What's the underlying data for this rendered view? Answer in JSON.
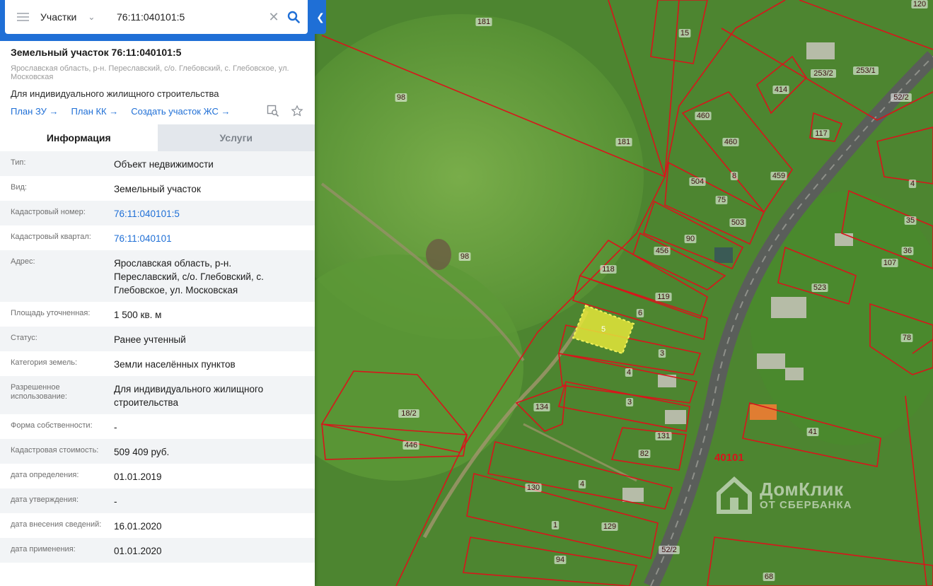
{
  "search": {
    "type_label": "Участки",
    "query": "76:11:040101:5"
  },
  "object": {
    "title": "Земельный участок 76:11:040101:5",
    "address": "Ярославская область, р-н. Переславский, с/о. Глебовский, с. Глебовское, ул. Московская",
    "use": "Для индивидуального жилищного строительства",
    "links": [
      "План ЗУ →",
      "План КК →",
      "Создать участок ЖС →"
    ]
  },
  "tabs": {
    "info": "Информация",
    "services": "Услуги"
  },
  "info_rows": [
    {
      "label": "Тип:",
      "value": "Объект недвижимости"
    },
    {
      "label": "Вид:",
      "value": "Земельный участок"
    },
    {
      "label": "Кадастровый номер:",
      "value": "76:11:040101:5"
    },
    {
      "label": "Кадастровый квартал:",
      "value": "76:11:040101"
    },
    {
      "label": "Адрес:",
      "value": "Ярославская область, р-н. Переславский, с/о. Глебовский, с. Глебовское, ул. Московская"
    },
    {
      "label": "Площадь уточненная:",
      "value": "1 500 кв. м"
    },
    {
      "label": "Статус:",
      "value": "Ранее учтенный"
    },
    {
      "label": "Категория земель:",
      "value": "Земли населённых пунктов"
    },
    {
      "label": "Разрешенное использование:",
      "value": "Для индивидуального жилищного строительства"
    },
    {
      "label": "Форма собственности:",
      "value": "-"
    },
    {
      "label": "Кадастровая стоимость:",
      "value": "509 409 руб."
    },
    {
      "label": "дата определения:",
      "value": "01.01.2019"
    },
    {
      "label": "дата утверждения:",
      "value": "-"
    },
    {
      "label": "дата внесения сведений:",
      "value": "16.01.2020"
    },
    {
      "label": "дата применения:",
      "value": "01.01.2020"
    }
  ],
  "map": {
    "parcel_labels": [
      "181",
      "15",
      "98",
      "98",
      "181",
      "460",
      "460",
      "8",
      "459",
      "504",
      "75",
      "503",
      "90",
      "456",
      "118",
      "119",
      "6",
      "5",
      "3",
      "4",
      "3",
      "134",
      "131",
      "82",
      "130",
      "4",
      "129",
      "1",
      "94",
      "52/2",
      "68",
      "18/2",
      "446",
      "41",
      "78",
      "523",
      "36",
      "107",
      "35",
      "4",
      "117",
      "414",
      "253/2",
      "253/1",
      "52/2",
      "120",
      "40101"
    ],
    "quarter_label": "40101"
  },
  "watermark": {
    "brand": "ДомКлик",
    "sub": "ОТ СБЕРБАНКА"
  },
  "colors": {
    "accent": "#1f6fd6",
    "parcel_border": "#d8151b",
    "selected_parcel": "#e4e53a"
  }
}
